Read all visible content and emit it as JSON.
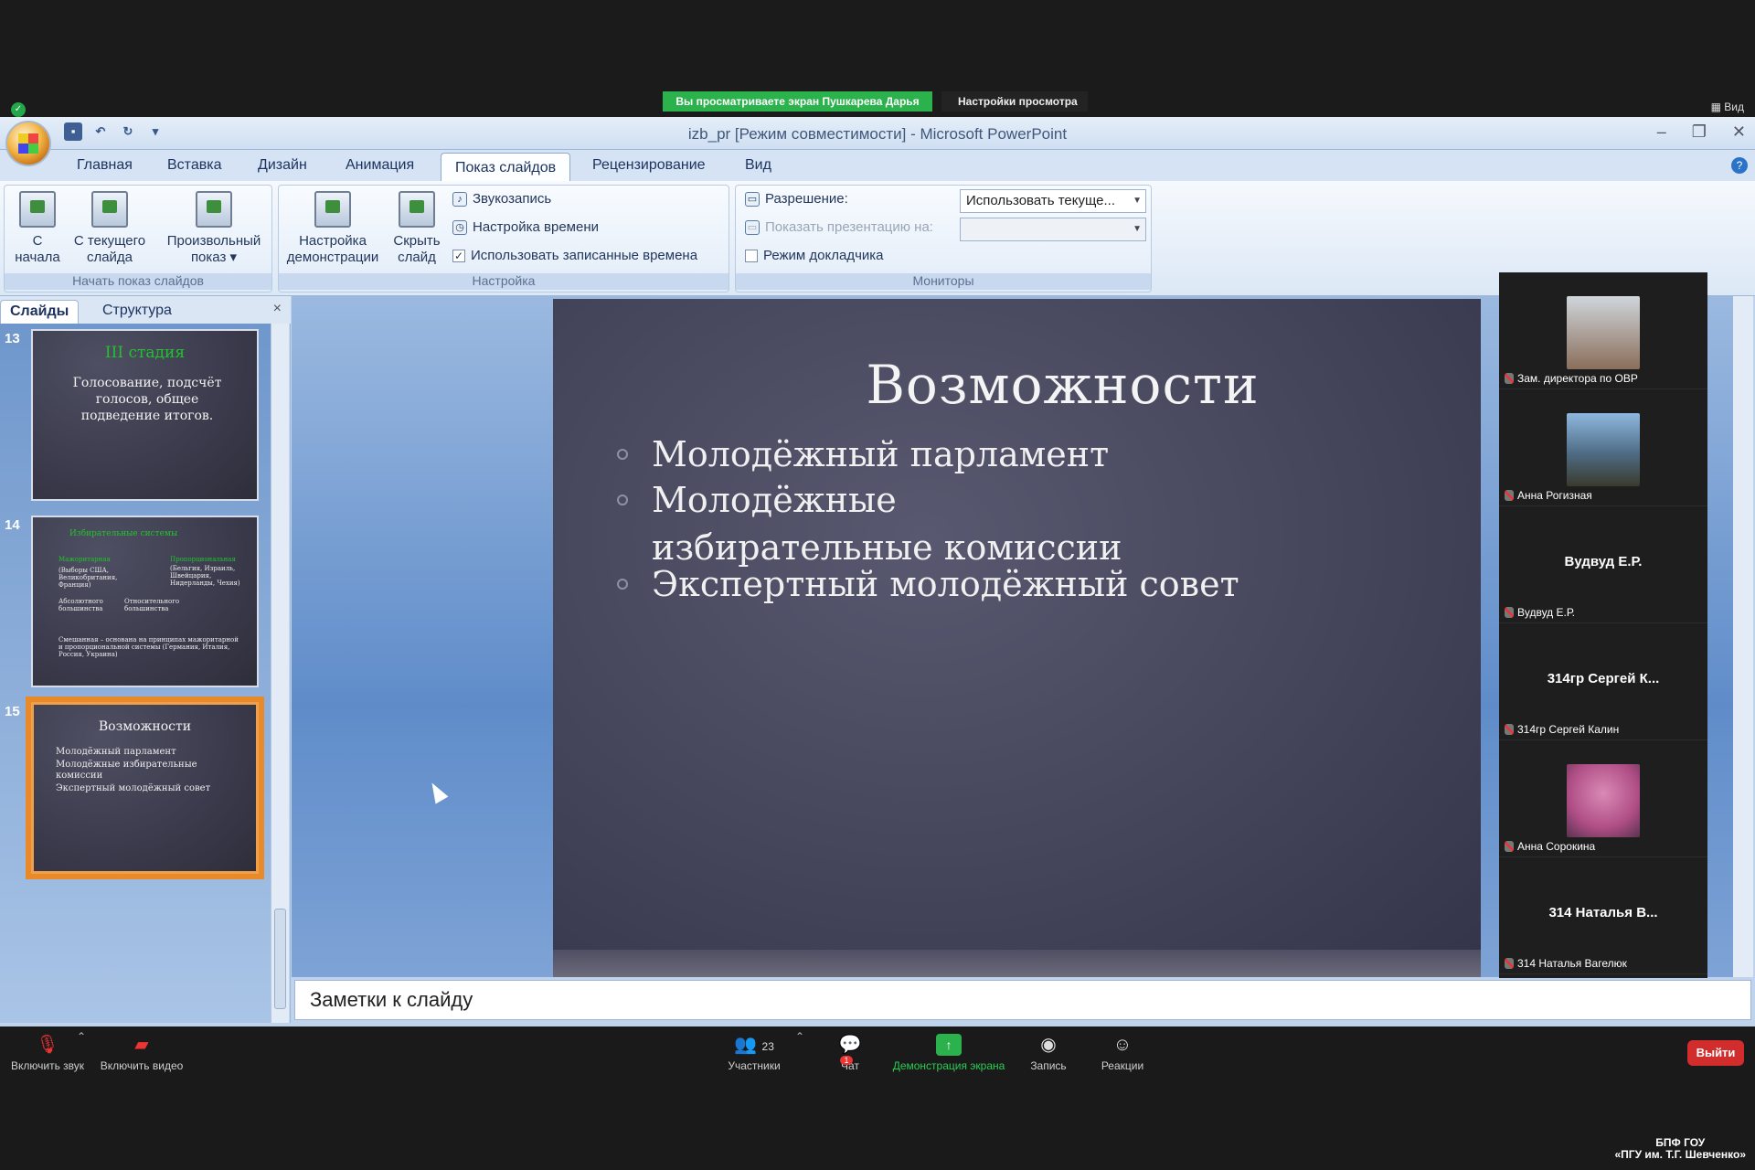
{
  "zoom_top": {
    "share_banner": "Вы просматриваете экран Пушкарева Дарья",
    "view_options": "Настройки просмотра ⌄",
    "view_label": "Вид"
  },
  "window": {
    "title": "izb_pr [Режим совместимости] - Microsoft PowerPoint"
  },
  "ribbon_tabs": [
    "Главная",
    "Вставка",
    "Дизайн",
    "Анимация",
    "Показ слайдов",
    "Рецензирование",
    "Вид"
  ],
  "ribbon": {
    "group_start": {
      "label": "Начать показ слайдов",
      "from_start_1": "С",
      "from_start_2": "начала",
      "from_current_1": "С текущего",
      "from_current_2": "слайда",
      "custom_1": "Произвольный",
      "custom_2": "показ ▾"
    },
    "group_setup": {
      "label": "Настройка",
      "setup_1": "Настройка",
      "setup_2": "демонстрации",
      "hide_1": "Скрыть",
      "hide_2": "слайд",
      "record": "Звукозапись",
      "timing": "Настройка времени",
      "use_timings": "Использовать записанные времена"
    },
    "group_monitors": {
      "label": "Мониторы",
      "resolution": "Разрешение:",
      "resolution_value": "Использовать текуще...",
      "show_on": "Показать презентацию на:",
      "presenter_view": "Режим докладчика"
    }
  },
  "left_panel": {
    "tab_slides": "Слайды",
    "tab_outline": "Структура",
    "close": "×",
    "slides": [
      {
        "num": "13",
        "title": "III стадия",
        "body": "Голосование, подсчёт голосов, общее подведение итогов."
      },
      {
        "num": "14",
        "title": "Избирательные системы",
        "lines": [
          "Мажоритарная",
          "Пропорциональная",
          "(Выборы США, Великобритания, Франция)",
          "(Бельгия, Израиль, Швейцария, Нидерланды, Чехия)",
          "Абсолютного большинства",
          "Относительного большинства",
          "Смешанная – основана на принципах мажоритарной и пропорциональной системы (Германия, Италия, Россия, Украина)"
        ]
      },
      {
        "num": "15",
        "title": "Возможности",
        "lines": [
          "Молодёжный парламент",
          "Молодёжные избирательные комиссии",
          "Экспертный молодёжный совет"
        ]
      }
    ]
  },
  "slide": {
    "title": "Возможности",
    "bullets": [
      "Молодёжный  парламент",
      "Молодёжные  избирательные комиссии",
      "Экспертный  молодёжный  совет"
    ]
  },
  "notes_placeholder": "Заметки к слайду",
  "participants": [
    {
      "label": "Зам. директора по ОВР",
      "photo": true,
      "photo_color": "#8a6e5a"
    },
    {
      "label": "Анна Рогизная",
      "photo": true,
      "photo_color": "#4e6c85"
    },
    {
      "label": "Вудвуд Е.Р.",
      "bigname": "Вудвуд Е.Р."
    },
    {
      "label": "314гр Сергей Калин",
      "bigname": "314гр Сергей К..."
    },
    {
      "label": "Анна Сорокина",
      "photo": true,
      "photo_color": "#b04e86"
    },
    {
      "label": "314  Наталья Вагелюк",
      "bigname": "314  Наталья В..."
    }
  ],
  "zoom_bottom": {
    "mic": "Включить звук",
    "video": "Включить видео",
    "participants": "Участники",
    "participants_count": "23",
    "chat": "Чат",
    "chat_badge": "1",
    "share": "Демонстрация экрана",
    "record": "Запись",
    "reactions": "Реакции",
    "leave": "Выйти"
  },
  "watermark": {
    "line1": "БПФ ГОУ",
    "line2": "«ПГУ им. Т.Г. Шевченко»"
  },
  "colors": {
    "zoom_green": "#2bb24c",
    "leave_red": "#d22d2d",
    "selected_thumb": "#e88a2a",
    "slide_bg": "#44445a"
  }
}
